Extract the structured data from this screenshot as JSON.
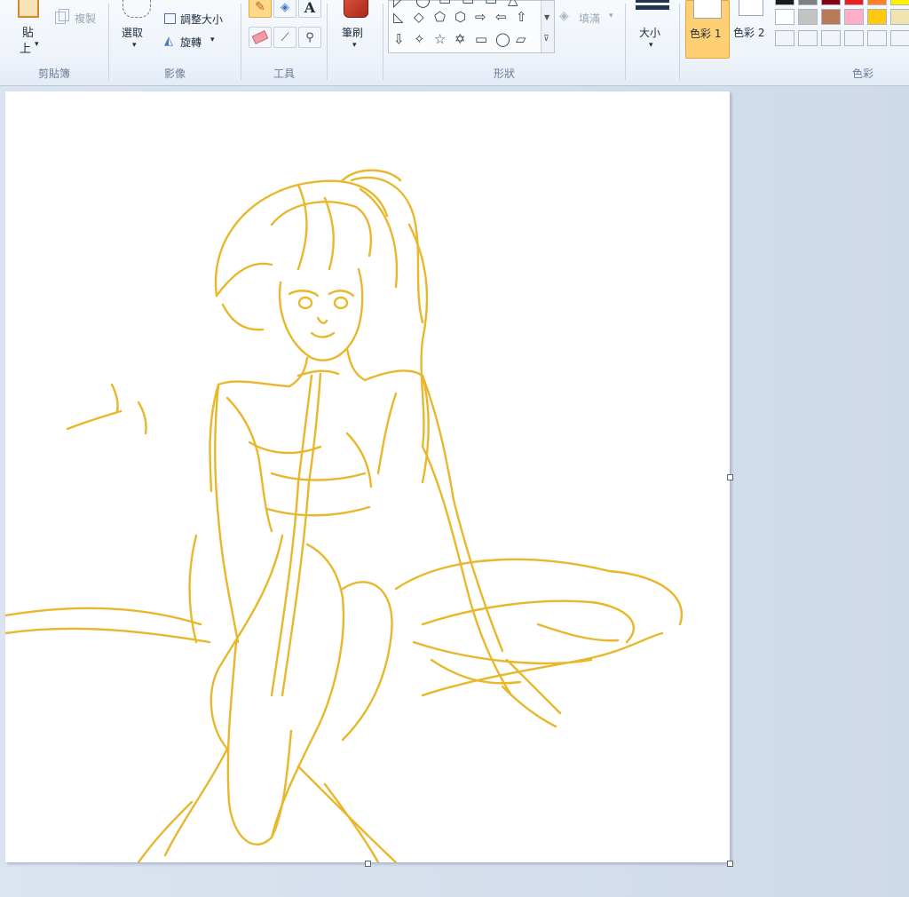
{
  "ribbon": {
    "clipboard": {
      "paste_label_top": "貼",
      "paste_label_bottom": "上",
      "copy_label": "複製",
      "group_label": "剪貼簿"
    },
    "image": {
      "select_label": "選取",
      "resize_label": "調整大小",
      "rotate_label": "旋轉",
      "group_label": "影像"
    },
    "tools": {
      "text_tool": "A",
      "group_label": "工具"
    },
    "brushes": {
      "label": "筆刷"
    },
    "shapes": {
      "fill_label": "填滿",
      "group_label": "形狀",
      "row1": [
        "◺",
        "◇",
        "⬠",
        "⬡",
        "⇨",
        "⇦",
        "⇧"
      ],
      "row2": [
        "⇩",
        "✧",
        "☆",
        "✡",
        "▭",
        "◯",
        "▱"
      ]
    },
    "size": {
      "label": "大小"
    },
    "colors": {
      "color1_label": "色彩 1",
      "color2_label": "色彩 2",
      "group_label": "色彩",
      "palette_row0": [
        "#1a1a1a",
        "#7f7f7f",
        "#880015",
        "#ed1c24",
        "#ff7f27",
        "#fff200"
      ],
      "palette_row1": [
        "#ffffff",
        "#c3c3c3",
        "#b97a57",
        "#ffaec9",
        "#ffc90e",
        "#efe4b0"
      ],
      "palette_row2": [
        "#f1f4f8",
        "#f1f4f8",
        "#f1f4f8",
        "#f1f4f8",
        "#f1f4f8",
        "#f1f4f8"
      ],
      "accent": "#ffc862",
      "stroke": "#e8b72c"
    }
  },
  "canvas": {
    "content": "sketch"
  }
}
